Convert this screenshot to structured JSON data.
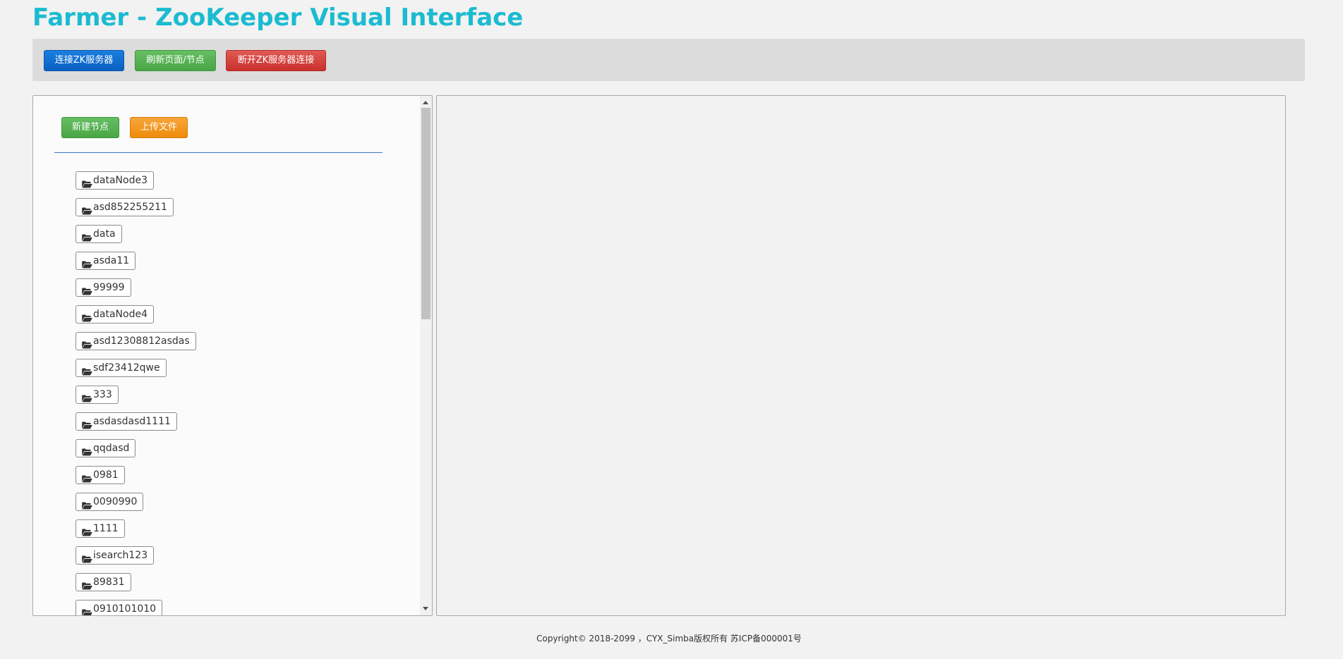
{
  "app": {
    "title": "Farmer - ZooKeeper Visual Interface"
  },
  "toolbar": {
    "connect_label": "连接ZK服务器",
    "refresh_label": "刷新页面/节点",
    "disconnect_label": "断开ZK服务器连接"
  },
  "tree_panel": {
    "new_node_label": "新建节点",
    "upload_file_label": "上传文件",
    "node_icon": "folder-open-icon",
    "nodes": [
      {
        "label": "dataNode3"
      },
      {
        "label": "asd852255211"
      },
      {
        "label": "data"
      },
      {
        "label": "asda11"
      },
      {
        "label": "99999"
      },
      {
        "label": "dataNode4"
      },
      {
        "label": "asd12308812asdas"
      },
      {
        "label": "sdf23412qwe"
      },
      {
        "label": "333"
      },
      {
        "label": "asdasdasd1111"
      },
      {
        "label": "qqdasd"
      },
      {
        "label": "0981"
      },
      {
        "label": "0090990"
      },
      {
        "label": "1111"
      },
      {
        "label": "isearch123"
      },
      {
        "label": "89831"
      },
      {
        "label": "0910101010"
      }
    ]
  },
  "footer": {
    "copyright": "Copyright© 2018-2099 ，CYX_Simba版权所有 苏ICP备000001号"
  },
  "colors": {
    "title": "#1bbbd1",
    "connect_button": "#0a5fc2",
    "refresh_button": "#48a545",
    "disconnect_button": "#c9302c",
    "new_node_button": "#48a545",
    "upload_button": "#ef8b0b",
    "divider": "#3e79c8"
  }
}
